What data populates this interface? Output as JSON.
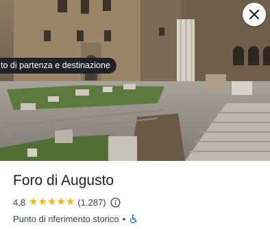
{
  "place": {
    "chip_label": "to di partenza e destinazione",
    "name": "Foro di Augusto",
    "rating": "4,8",
    "stars": [
      "★",
      "★",
      "★",
      "★",
      "★"
    ],
    "review_count": "(1.287)",
    "category": "Punto di riferimento storico",
    "separator": "•"
  },
  "icons": {
    "close": "close-icon",
    "info": "info-icon",
    "accessibility": "wheelchair-icon"
  },
  "colors": {
    "star": "#f6b400",
    "accessibility": "#1a73e8",
    "chip_background": "#202124"
  }
}
